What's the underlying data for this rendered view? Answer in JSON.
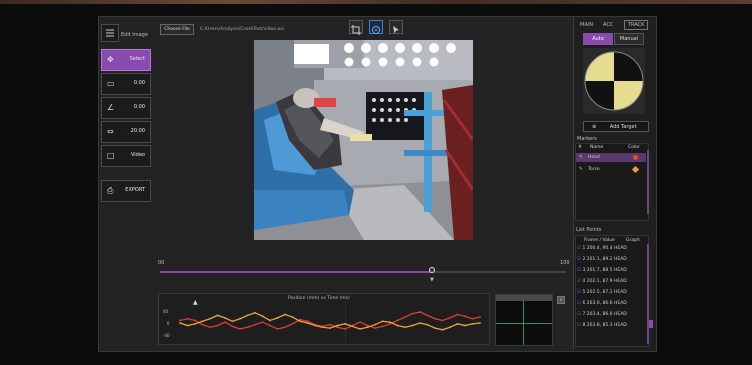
{
  "top_toolbar": {
    "icons": [
      "crop-icon",
      "target-icon",
      "cursor-icon"
    ]
  },
  "left_panel": {
    "toggle_label": "Edit Image",
    "tools": [
      {
        "icon": "move-icon",
        "label": "Select",
        "active": true
      },
      {
        "icon": "ruler-icon",
        "label": "0.00",
        "active": false
      },
      {
        "icon": "angle-icon",
        "label": "0.00",
        "active": false
      },
      {
        "icon": "scale-icon",
        "label": "20.00",
        "active": false
      },
      {
        "icon": "frame-icon",
        "label": "Video",
        "active": false
      }
    ],
    "export_label": "EXPORT"
  },
  "path_bar": {
    "choose_label": "Choose File",
    "path": "C:/Users/Analysis/CrashTest/video.avi"
  },
  "timeline": {
    "start_label": "00",
    "end_label": "100",
    "position": 0.67
  },
  "graph": {
    "title": "Position (mm) vs Time (ms)",
    "y_labels": [
      "40",
      "0",
      "-40"
    ]
  },
  "right_panel": {
    "tabs": [
      "MAIN",
      "ACC",
      "TRACK"
    ],
    "mode_tabs": [
      "Auto",
      "Manual"
    ],
    "add_target_label": "Add Target",
    "markers_header": "Markers",
    "markers_columns": [
      "#",
      "Name",
      "Color"
    ],
    "markers": [
      {
        "name": "Head",
        "color": "#e24d2f"
      },
      {
        "name": "Torso",
        "color": "#e8a030"
      }
    ],
    "list_header": "List Points",
    "list_columns": [
      "Frame / Value",
      "Graph"
    ],
    "list_rows": [
      "1    200.4, 90.4  HEAD",
      "2    201.1, 89.2  HEAD",
      "3    201.7, 88.5  HEAD",
      "4    202.1, 87.9  HEAD",
      "5    202.5, 87.1  HEAD",
      "6    203.0, 86.6  HEAD",
      "7    203.4, 86.0  HEAD",
      "8    203.8, 85.3  HEAD"
    ]
  },
  "chart_data": {
    "type": "line",
    "title": "Position (mm) vs Time (ms)",
    "x": [
      0,
      1,
      2,
      3,
      4,
      5,
      6,
      7,
      8,
      9,
      10,
      11,
      12,
      13,
      14,
      15,
      16,
      17,
      18,
      19,
      20,
      21,
      22,
      23,
      24,
      25,
      26,
      27,
      28,
      29,
      30,
      31,
      32,
      33,
      34,
      35,
      36,
      37,
      38,
      39,
      40
    ],
    "series": [
      {
        "color": "#e03a3a",
        "values": [
          6,
          10,
          6,
          -4,
          -10,
          -6,
          2,
          -8,
          -14,
          -10,
          -4,
          2,
          -6,
          -14,
          -10,
          -2,
          8,
          4,
          -4,
          -8,
          -4,
          -10,
          -14,
          -6,
          2,
          -6,
          -12,
          -8,
          -2,
          6,
          14,
          22,
          26,
          18,
          10,
          6,
          12,
          20,
          16,
          10,
          14
        ]
      },
      {
        "color": "#e8a23a",
        "values": [
          0,
          -6,
          -2,
          4,
          10,
          18,
          12,
          4,
          10,
          18,
          24,
          16,
          6,
          12,
          20,
          14,
          4,
          0,
          -6,
          -10,
          -12,
          -6,
          -2,
          -8,
          -14,
          -10,
          -4,
          4,
          2,
          -6,
          -10,
          -6,
          0,
          -4,
          -12,
          -16,
          -10,
          -2,
          -6,
          -2,
          0
        ]
      }
    ]
  },
  "colors": {
    "accent": "#8a4bb0",
    "panel": "#232323",
    "border": "#4a4a4a"
  }
}
